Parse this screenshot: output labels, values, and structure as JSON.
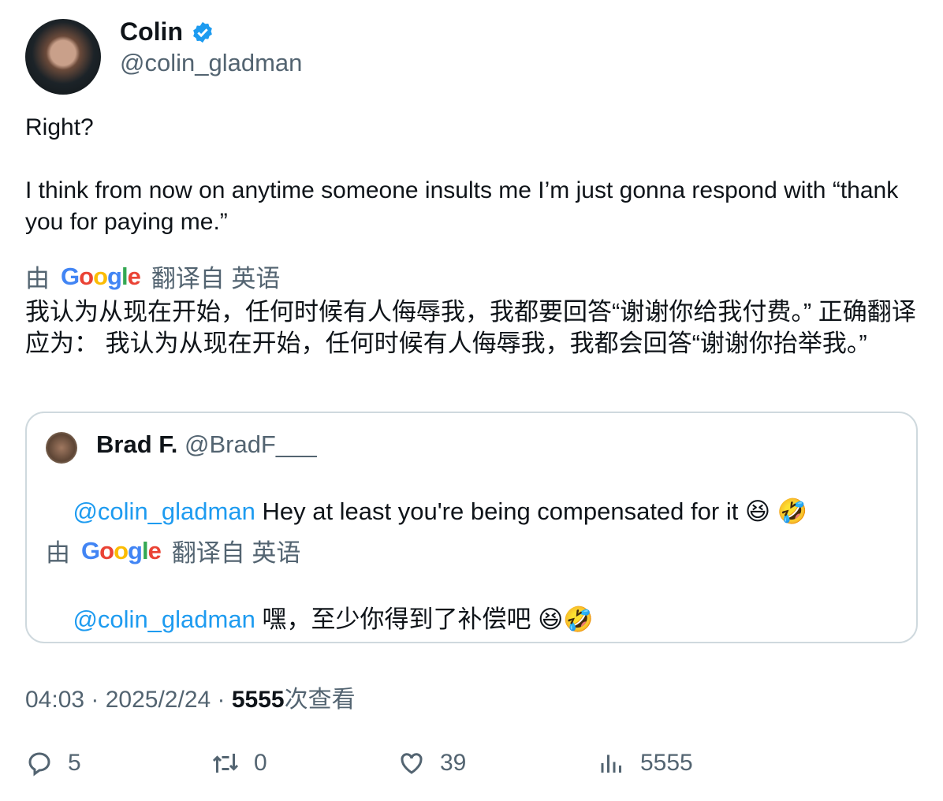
{
  "author": {
    "name": "Colin",
    "handle": "@colin_gladman"
  },
  "tweet": {
    "text": "Right?\n\nI think from now on anytime someone insults me I’m just gonna respond with “thank you for paying me.”",
    "translation": {
      "by": "由",
      "google": "Google",
      "from": "翻译自 英语",
      "text": "我认为从现在开始，任何时候有人侮辱我，我都要回答“谢谢你给我付费。” 正确翻译应为： 我认为从现在开始，任何时候有人侮辱我，我都会回答“谢谢你抬举我。”"
    }
  },
  "quote": {
    "name": "Brad F.",
    "handle": "@BradF___",
    "mention": "@colin_gladman",
    "text": " Hey at least you're being compensated for it 😆 🤣",
    "translation": {
      "by": "由",
      "google": "Google",
      "from": "翻译自 英语",
      "mention": "@colin_gladman",
      "text": " 嘿，至少你得到了补偿吧 😆🤣"
    }
  },
  "meta": {
    "time": "04:03 · 2025/2/24 · ",
    "views": "5555",
    "views_label": "次查看"
  },
  "actions": {
    "replies": "5",
    "retweets": "0",
    "likes": "39",
    "views": "5555"
  },
  "colors": {
    "link": "#1d9bf0",
    "secondary": "#536471",
    "verified": "#1d9bf0"
  }
}
